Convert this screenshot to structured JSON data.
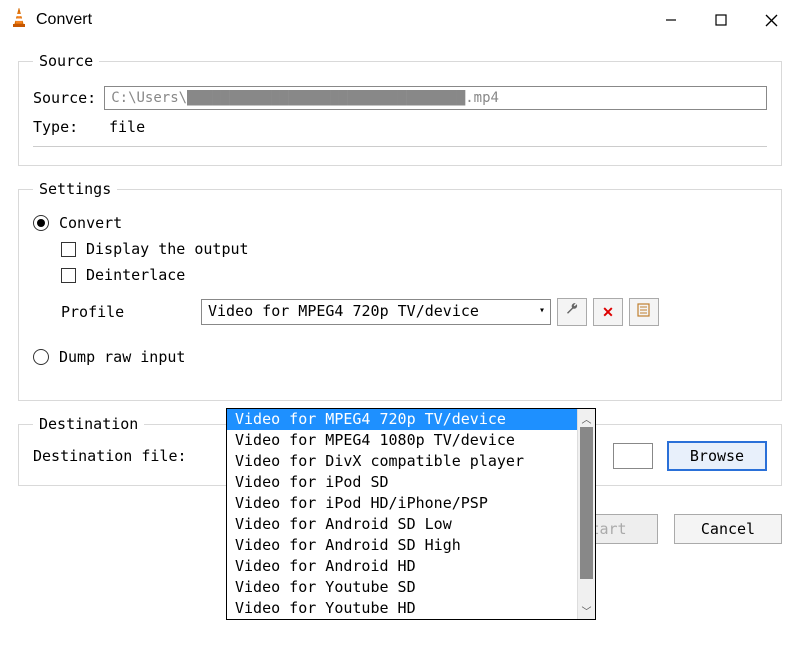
{
  "window": {
    "title": "Convert"
  },
  "source": {
    "legend": "Source",
    "source_label": "Source:",
    "source_value": "C:\\Users\\█████████████████████████████████.mp4",
    "type_label": "Type:",
    "type_value": "file"
  },
  "settings": {
    "legend": "Settings",
    "convert_label": "Convert",
    "display_label": "Display the output",
    "deinterlace_label": "Deinterlace",
    "profile_label": "Profile",
    "profile_selected": "Video for MPEG4 720p TV/device",
    "profile_options": [
      "Video for MPEG4 720p TV/device",
      "Video for MPEG4 1080p TV/device",
      "Video for DivX compatible player",
      "Video for iPod SD",
      "Video for iPod HD/iPhone/PSP",
      "Video for Android SD Low",
      "Video for Android SD High",
      "Video for Android HD",
      "Video for Youtube SD",
      "Video for Youtube HD"
    ],
    "dump_label": "Dump raw input"
  },
  "destination": {
    "legend": "Destination",
    "file_label": "Destination file:",
    "browse_label": "Browse"
  },
  "footer": {
    "start_label": "Start",
    "cancel_label": "Cancel"
  }
}
